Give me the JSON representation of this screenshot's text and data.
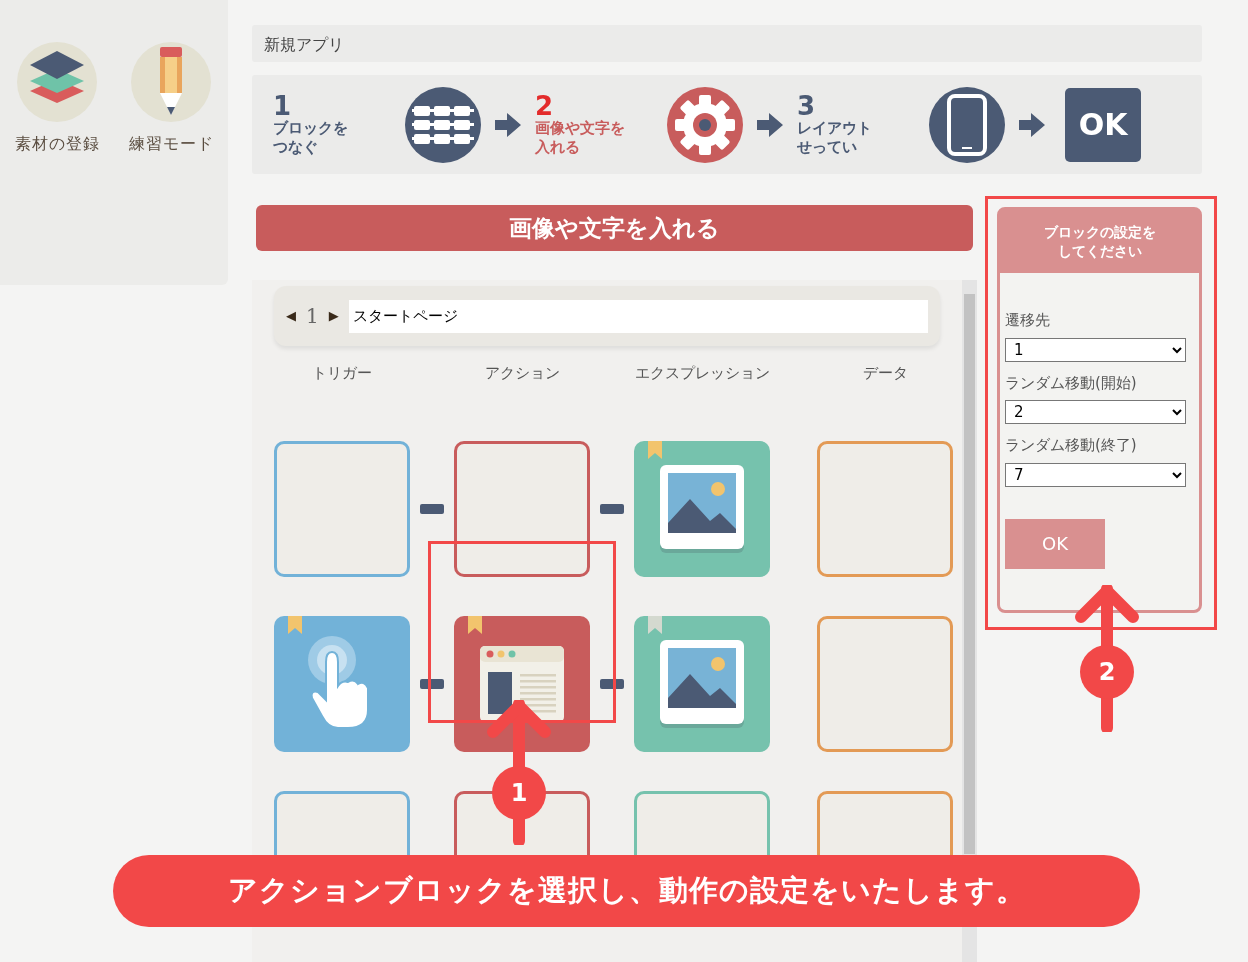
{
  "sidebar": {
    "items": [
      {
        "label": "素材の登録"
      },
      {
        "label": "練習モード"
      }
    ]
  },
  "app_title": "新規アプリ",
  "steps": [
    {
      "number": "1",
      "label_lines": [
        "ブロックを",
        "つなぐ"
      ],
      "selected": false
    },
    {
      "number": "2",
      "label_lines": [
        "画像や文字を",
        "入れる"
      ],
      "selected": true
    },
    {
      "number": "3",
      "label_lines": [
        "レイアウト",
        "せってい"
      ],
      "selected": false
    }
  ],
  "finish_button": "OK",
  "section_title": "画像や文字を入れる",
  "page_nav": {
    "prev": "◀",
    "number": "1",
    "next": "▶",
    "page_name": "スタートページ"
  },
  "columns": [
    {
      "label": "トリガー",
      "color": "#72b2d8"
    },
    {
      "label": "アクション",
      "color": "#c85c5c"
    },
    {
      "label": "エクスプレッション",
      "color": "#76c2ad"
    },
    {
      "label": "データ",
      "color": "#e39a55"
    }
  ],
  "rows": [
    {
      "cells": [
        {
          "kind": "empty"
        },
        {
          "kind": "empty"
        },
        {
          "kind": "image",
          "color": "#f2c46d"
        },
        {
          "kind": "empty"
        }
      ]
    },
    {
      "cells": [
        {
          "kind": "touch",
          "color": "#f2c46d"
        },
        {
          "kind": "browser",
          "color": "#f2c46d"
        },
        {
          "kind": "image",
          "color": "#d4d9cf"
        },
        {
          "kind": "empty"
        }
      ]
    },
    {
      "cells": [
        {
          "kind": "empty"
        },
        {
          "kind": "empty"
        },
        {
          "kind": "empty"
        },
        {
          "kind": "empty"
        }
      ]
    }
  ],
  "settings": {
    "title_lines": [
      "ブロックの設定を",
      "してください"
    ],
    "fields": [
      {
        "label": "遷移先",
        "value": "1"
      },
      {
        "label": "ランダム移動(開始)",
        "value": "2"
      },
      {
        "label": "ランダム移動(終了)",
        "value": "7"
      }
    ],
    "ok": "OK"
  },
  "callouts": [
    {
      "number": "1"
    },
    {
      "number": "2"
    }
  ],
  "caption": "アクションブロックを選択し、動作の設定をいたします。"
}
